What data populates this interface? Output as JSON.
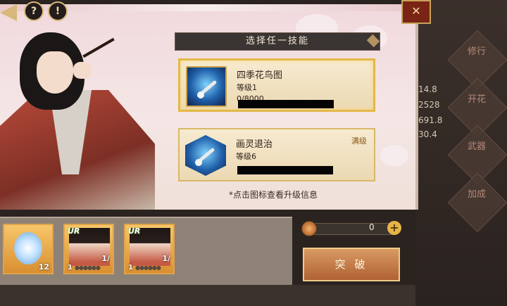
{
  "header": {
    "title": "选择任一技能"
  },
  "skills": [
    {
      "name": "四季花鸟图",
      "level": "等级1",
      "progress": "0/8000",
      "selected": true,
      "maxed_label": ""
    },
    {
      "name": "画灵退治",
      "level": "等级6",
      "progress": "",
      "selected": false,
      "maxed_label": "满级"
    }
  ],
  "hint": "*点击图标查看升级信息",
  "right_sidebar": {
    "tabs": [
      "修行",
      "开花",
      "武器",
      "加成"
    ],
    "stats": [
      "14.8",
      "2528",
      "691.8",
      "30.4"
    ]
  },
  "inventory": {
    "items": [
      {
        "type": "mirror",
        "count": "12"
      },
      {
        "type": "card",
        "rarity": "UR",
        "level": "1",
        "ratio": "1/"
      },
      {
        "type": "card",
        "rarity": "UR",
        "level": "1",
        "ratio": "1/"
      }
    ]
  },
  "currency": {
    "value": "0"
  },
  "breakthrough_label": "突 破",
  "colors": {
    "accent_gold": "#d8b868",
    "button": "#b06133"
  }
}
